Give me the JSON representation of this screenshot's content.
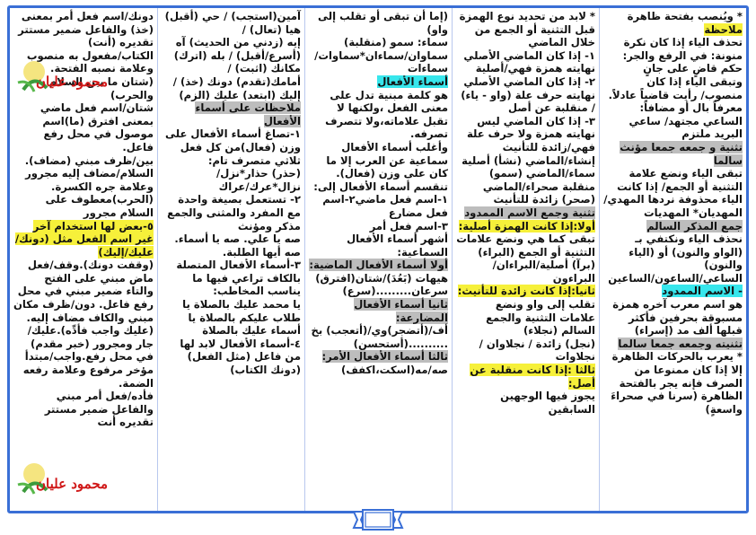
{
  "columns": [
    {
      "blocks": [
        {
          "text": "* ويُنصب بفتحة ظاهرة"
        },
        {
          "text": "ملاحظة",
          "hl": "y"
        },
        {
          "text": "تحذف الياء إذا كان نكرة منونة: في الرفع والجر: حكم قاضٍ على جانٍ"
        },
        {
          "text": "وتبقى الياء إذا كان منصوب/ رأيت قاضياً عادلاً. معرفاً بال أو مضافاً:"
        },
        {
          "text": "الساعي مجتهد/ ساعي البريد ملتزم"
        },
        {
          "text": "تثنية و جمعه جمعا مؤنث سالما",
          "hl": "g"
        },
        {
          "text": "تبقى الياء ونضع علامة التثنية أو الجمع/ إذا كانت الياء محذوفة نردها المهدي/المهديان* المهديات"
        },
        {
          "text": "جمع المذكر السالم",
          "hl": "g"
        },
        {
          "text": "نحذف الياء ونكتفي بـ (الواو والنون) أو (الياء والنون)"
        },
        {
          "text": "الساعي/الساعون/الساعين"
        },
        {
          "text": "- الاسم الممدود",
          "hl": "c"
        },
        {
          "text": "هو اسم معرب آخره همزة مسبوقة بحرفين فأكثر قبلها ألف مد (إسراء)"
        },
        {
          "text": "تثنيته وجمعه جمعا سالما",
          "hl": "g"
        },
        {
          "text": "* يعرب بالحركات الظاهرة إلا إذا كان ممنوعا من الصرف فإنه يجر بالفتحة الظاهرة (سرنا في صحراءَ واسعةٍ)"
        }
      ]
    },
    {
      "blocks": [
        {
          "text": "* لابد من تحديد نوع الهمزة قبل التثنية أو الجمع من خلال الماضي"
        },
        {
          "text": "١- إذا كان الماضي الأصلي نهايته همزة فهي/أصلية"
        },
        {
          "text": "٢- إذا كان الماضي الأصلي نهايته حرف علة (واو - ياء) / منقلبة عن أصل"
        },
        {
          "text": "٣- إذا كان الماضي ليس نهايته همزة ولا حرف علة فهي/زائدة للتأنيث"
        },
        {
          "text": "إنشاء/الماضي (نشأ) أصلية سماء/الماضي (سمو) منقلبة صحراء/الماضي (صحر) زائدة للتأنيث"
        },
        {
          "text": "تثنية وجمع الاسم الممدود",
          "hl": "g"
        },
        {
          "text": "أولا:إذا كانت الهمزة أصلية:",
          "hl": "y"
        },
        {
          "text": "تبقى كما هي ونضع علامات التثنية أو الجمع (البراء) (برآ) أصلية/البراءان/البراءون"
        },
        {
          "text": "ثانيا:إذا كانت زائدة للتأنيث:",
          "hl": "y"
        },
        {
          "text": "تقلب إلى واو ونضع علامات التثنية والجمع السالم (نجلاء)"
        },
        {
          "text": "(نجل) زائدة / نجلاوان / نجلاوات"
        },
        {
          "text": "ثالثا :إذا كانت منقلبة عن أصل:",
          "hl": "y"
        },
        {
          "text": "يجوز فيها الوجهين السابقين"
        }
      ]
    },
    {
      "blocks": [
        {
          "text": "(إما أن تبقى أو تقلب إلى واو)"
        },
        {
          "text": "سماء: سمو (منقلبة) سماوان/سماءان*سماوات/سماءات"
        },
        {
          "text": "أسماء الأفعال",
          "hl": "c"
        },
        {
          "text": "هو كلمة مبنية تدل على معنى الفعل ،ولكنها لا تقبل علاماته،ولا تتصرف تصرفه."
        },
        {
          "text": "وأغلب أسماء الأفعال سماعية عن العرب إلا ما كان على وزن (فعال)."
        },
        {
          "text": "تنقسم أسماء الأفعال إلى:"
        },
        {
          "text": "١-اسم فعل ماضي٢-اسم فعل مضارع"
        },
        {
          "text": "٣-اسم فعل أمر"
        },
        {
          "text": "أشهر أسماء الأفعال السماعية:"
        },
        {
          "text": "أولا أسماء الأفعال الماضية:",
          "hl": "g"
        },
        {
          "text": "هيهات (بَعُدَ)/شتان(افترق) سرعان.........(سرع)"
        },
        {
          "text": "ثانيا أسماء الأفعال المضارعة:",
          "hl": "g"
        },
        {
          "text": "أف/(أتضجر)وي/(أتعجب) بخ ..........(أستحسن)"
        },
        {
          "text": "ثالثا أسماء الأفعال الأمر:",
          "hl": "g"
        },
        {
          "text": "صه/مه(اسكت،اكفف)"
        }
      ]
    },
    {
      "blocks": [
        {
          "text": "آمين(استجب) / حي (أقبل) هيا (تعال) /"
        },
        {
          "text": "إيه (زدني من الحديث) آه (أسرع/أقبل) / بله (اترك)"
        },
        {
          "text": "مكانك (اثبت) / أمامك(تقدم) دونك (خذ) / إليك (ابتعد) عليك (الزم)"
        },
        {
          "text": "ملاحظات على أسماء الأفعال",
          "hl": "g"
        },
        {
          "text": "١-تصاغ أسماء الأفعال على وزن (فعال)من كل فعل ثلاثي متصرف تام:"
        },
        {
          "text": "(حذر) حذار*نزل/نزال*عرك/عراك"
        },
        {
          "text": "٢- تستعمل بصيغة واحدة مع المفرد والمثنى والجمع مذكر ومؤنث"
        },
        {
          "text": "صه يا علي. صه يا أسماء. صه أيها الطلبة."
        },
        {
          "text": "٣-أسماء الأفعال المتصلة بالكاف تراعي فيها ما يناسب المخاطب:"
        },
        {
          "text": "يا محمد عليك بالصلاة يا طلاب عليكم بالصلاة يا أسماء عليك بالصلاة"
        },
        {
          "text": "٤-أسماء الأفعال لابد لها من فاعل (مثل الفعل) (دونك الكتاب)"
        }
      ]
    },
    {
      "blocks": [
        {
          "text": "دونك/اسم فعل أمر بمعنى (خذ) والفاعل ضمير مستتر تقديره (أنت)"
        },
        {
          "text": "الكتاب/مفعول به منصوب وعلامة نصبه الفتحة."
        },
        {
          "text": "(شتان ما بين السلام والحرب)"
        },
        {
          "text": "شتان/اسم فعل ماضي بمعنى افترق (ما)اسم موصول في محل رفع فاعل."
        },
        {
          "text": "بين/ظرف مبني (مضاف). السلام/مضاف إليه مجرور وعلامة جره الكسرة."
        },
        {
          "text": "(الحرب)معطوف على السلام مجرور"
        },
        {
          "text": "٥-بعض لها استخدام آخر غير اسم الفعل مثل (دونك/عليك/إليك)",
          "hl": "y"
        },
        {
          "text": "(وقفت دونك).وقف/فعل ماض مبني على الفتح والتاء ضمير مبني في محل رفع فاعل. دون/ظرف مكان مبني والكاف مضاف إليه."
        },
        {
          "text": "(عليك واجب فأدِّه).عليك/جار ومجرور (خبر مقدم) في محل رفع.واجب/مبتدأ مؤخر مرفوع وعلامة رفعه الضمة."
        },
        {
          "text": "فأده/فعل أمر مبني والفاعل ضمير مستتر تقديره أنت"
        }
      ]
    }
  ],
  "watermark": {
    "name": "محمود عليان",
    "count": 2
  },
  "footer": {
    "icon": "next-page-ribbon-icon"
  },
  "colors": {
    "frame": "#3a6fd6",
    "highlight_yellow": "#f6f03a",
    "highlight_gray": "#bdbdbd",
    "highlight_cyan": "#37e6ec",
    "watermark": "#d01818"
  }
}
